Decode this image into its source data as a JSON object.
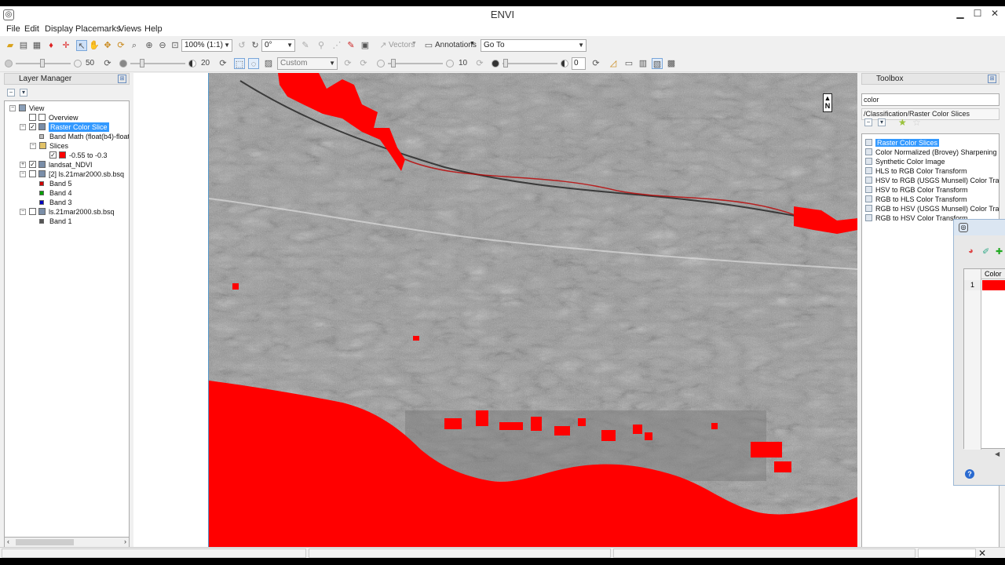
{
  "window": {
    "title": "ENVI",
    "minimize": "▁",
    "maximize": "☐",
    "close": "✕"
  },
  "menu": [
    "File",
    "Edit",
    "Display",
    "Placemarks",
    "Views",
    "Help"
  ],
  "toolbar1": {
    "zoom_value": "100% (1:1)",
    "rotation_value": "0°",
    "vectors_label": "Vectors",
    "annotations_label": "Annotations",
    "goto_value": "Go To"
  },
  "toolbar2": {
    "brightness_value": "50",
    "contrast_value": "20",
    "stretch_value": "Custom",
    "sharpen_value": "10",
    "transparency_value": "0"
  },
  "layer_manager": {
    "title": "Layer Manager",
    "tree": [
      {
        "label": "View",
        "depth": 0,
        "expanded": true,
        "checkbox": false,
        "icon": "view-icon"
      },
      {
        "label": "Overview",
        "depth": 1,
        "checkbox": true,
        "checked": false,
        "icon": "overview-icon"
      },
      {
        "label": "Raster Color Slice",
        "depth": 1,
        "expanded": true,
        "checkbox": true,
        "checked": true,
        "selected": true,
        "icon": "raster-icon"
      },
      {
        "label": "Band Math (float(b4)-float(b",
        "depth": 2,
        "icon": "band-math-icon"
      },
      {
        "label": "Slices",
        "depth": 2,
        "expanded": true,
        "icon": "folder-icon"
      },
      {
        "label": "-0.55 to -0.3",
        "depth": 3,
        "checkbox": true,
        "checked": true,
        "icon": "slice-color-icon"
      },
      {
        "label": "landsat_NDVI",
        "depth": 1,
        "expanded": false,
        "checkbox": true,
        "checked": true,
        "icon": "raster-icon"
      },
      {
        "label": "[2] ls.21mar2000.sb.bsq",
        "depth": 1,
        "expanded": true,
        "checkbox": true,
        "checked": false,
        "icon": "raster-icon"
      },
      {
        "label": "Band 5",
        "depth": 2,
        "icon": "band-red-icon"
      },
      {
        "label": "Band 4",
        "depth": 2,
        "icon": "band-green-icon"
      },
      {
        "label": "Band 3",
        "depth": 2,
        "icon": "band-blue-icon"
      },
      {
        "label": "ls.21mar2000.sb.bsq",
        "depth": 1,
        "expanded": true,
        "checkbox": true,
        "checked": false,
        "icon": "raster-icon"
      },
      {
        "label": "Band 1",
        "depth": 2,
        "icon": "band-gray-icon"
      }
    ]
  },
  "toolbox": {
    "title": "Toolbox",
    "search_value": "color",
    "path": "/Classification/Raster Color Slices",
    "items": [
      {
        "label": "Raster Color Slices",
        "selected": true
      },
      {
        "label": "Color Normalized (Brovey) Sharpening"
      },
      {
        "label": "Synthetic Color Image"
      },
      {
        "label": "HLS to RGB Color Transform"
      },
      {
        "label": "HSV to RGB (USGS Munsell) Color Tran"
      },
      {
        "label": "HSV to RGB Color Transform"
      },
      {
        "label": "RGB to HLS Color Transform"
      },
      {
        "label": "RGB to HSV (USGS Munsell) Color Tran"
      },
      {
        "label": "RGB to HSV Color Transform"
      }
    ]
  },
  "dialog": {
    "column_header": "Color",
    "row_number": "1",
    "slice_color": "#ff0000",
    "help": "?"
  },
  "view": {
    "north_label": "N",
    "slice_color": "#ff0000"
  },
  "status": {
    "close": "✕"
  }
}
